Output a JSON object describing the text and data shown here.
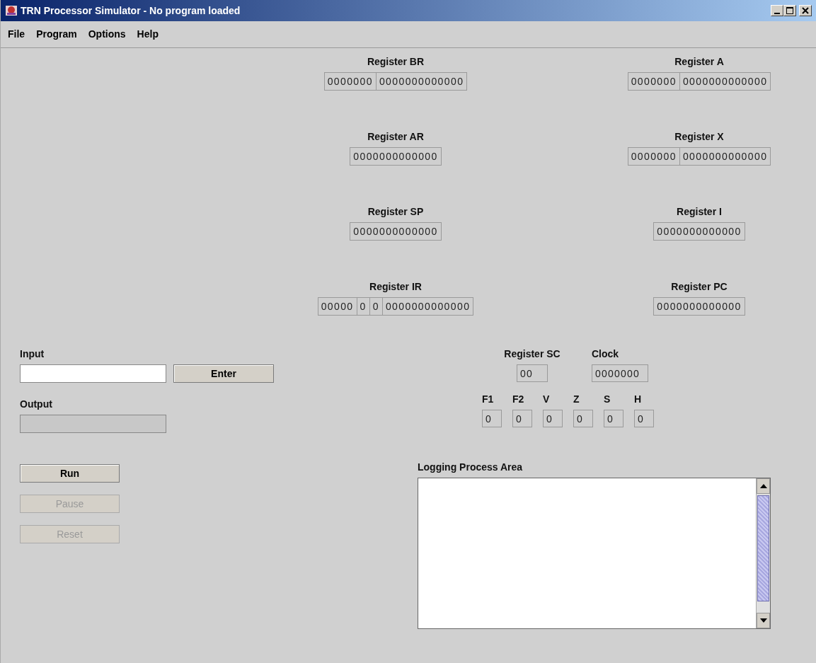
{
  "window": {
    "title": "TRN Processor Simulator - No program loaded"
  },
  "menu": [
    "File",
    "Program",
    "Options",
    "Help"
  ],
  "registers_left": [
    {
      "label": "Register BR",
      "fields": [
        "0000000",
        "0000000000000"
      ]
    },
    {
      "label": "Register AR",
      "fields": [
        "0000000000000"
      ]
    },
    {
      "label": "Register SP",
      "fields": [
        "0000000000000"
      ]
    },
    {
      "label": "Register IR",
      "fields": [
        "00000",
        "0",
        "0",
        "0000000000000"
      ]
    }
  ],
  "registers_right": [
    {
      "label": "Register A",
      "fields": [
        "0000000",
        "0000000000000"
      ]
    },
    {
      "label": "Register X",
      "fields": [
        "0000000",
        "0000000000000"
      ]
    },
    {
      "label": "Register I",
      "fields": [
        "0000000000000"
      ]
    },
    {
      "label": "Register PC",
      "fields": [
        "0000000000000"
      ]
    }
  ],
  "input": {
    "label": "Input",
    "disabled": false,
    "button": "Enter"
  },
  "output": {
    "label": "Output",
    "disabled": true
  },
  "controls": [
    {
      "label": "Run",
      "disabled": false
    },
    {
      "label": "Pause",
      "disabled": true
    },
    {
      "label": "Reset",
      "disabled": true
    }
  ],
  "register_sc": {
    "label": "Register SC",
    "value": "00"
  },
  "clock": {
    "label": "Clock",
    "value": "0000000"
  },
  "flags": [
    {
      "label": "F1",
      "value": "0"
    },
    {
      "label": "F2",
      "value": "0"
    },
    {
      "label": "V",
      "value": "0"
    },
    {
      "label": "Z",
      "value": "0"
    },
    {
      "label": "S",
      "value": "0"
    },
    {
      "label": "H",
      "value": "0"
    }
  ],
  "log": {
    "label": "Logging Process Area"
  }
}
